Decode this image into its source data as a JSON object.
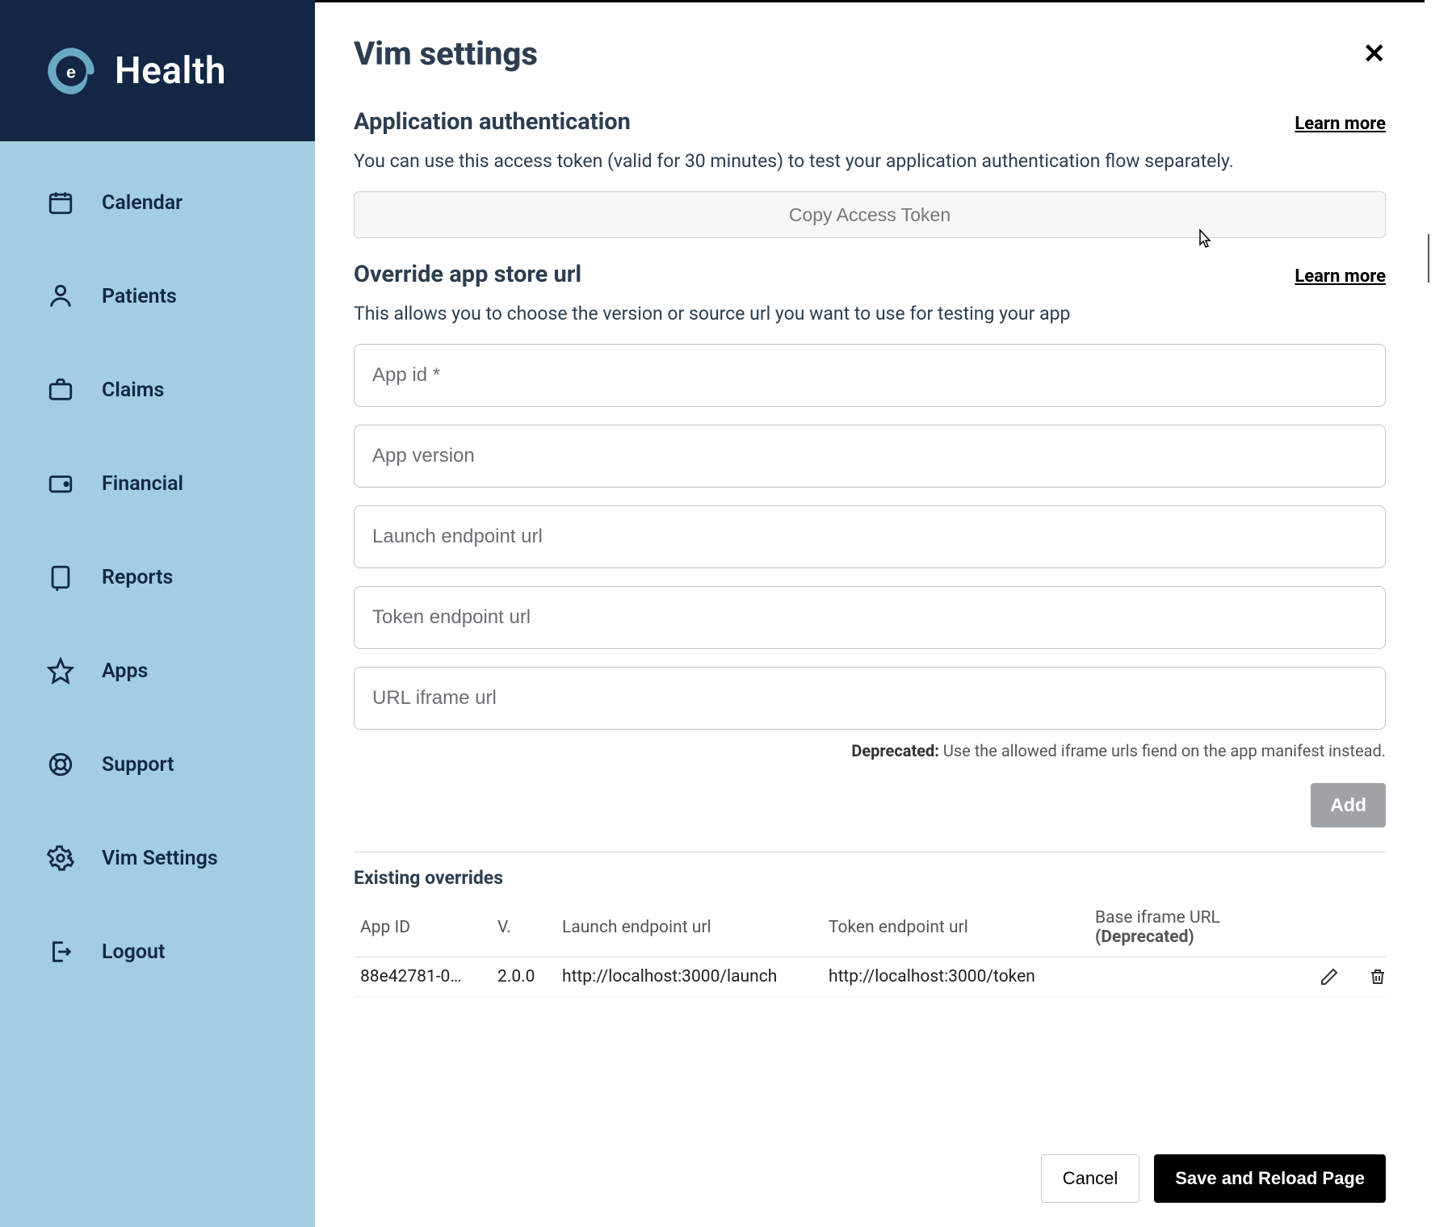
{
  "brand": {
    "name": "Health",
    "mark_letter": "e"
  },
  "sidebar": {
    "items": [
      {
        "label": "Calendar"
      },
      {
        "label": "Patients"
      },
      {
        "label": "Claims"
      },
      {
        "label": "Financial"
      },
      {
        "label": "Reports"
      },
      {
        "label": "Apps"
      },
      {
        "label": "Support"
      },
      {
        "label": "Vim Settings"
      },
      {
        "label": "Logout"
      }
    ]
  },
  "page": {
    "title": "Vim settings"
  },
  "auth": {
    "heading": "Application authentication",
    "learn": "Learn more",
    "desc": "You can use this access token (valid for 30 minutes) to test your application authentication flow separately.",
    "copy_btn": "Copy Access Token"
  },
  "override": {
    "heading": "Override app store url",
    "learn": "Learn more",
    "desc": "This allows you to choose the version or source url you want to use for testing your app",
    "placeholders": {
      "app_id": "App id *",
      "app_version": "App version",
      "launch_url": "Launch endpoint url",
      "token_url": "Token endpoint url",
      "iframe_url": "URL iframe url"
    },
    "deprecated_label": "Deprecated:",
    "deprecated_text": "Use the allowed iframe urls fiend on the app manifest instead.",
    "add_btn": "Add"
  },
  "overrides_table": {
    "heading": "Existing overrides",
    "cols": {
      "app_id": "App ID",
      "version": "V.",
      "launch": "Launch endpoint url",
      "token": "Token endpoint url",
      "iframe": "Base iframe URL",
      "iframe_deprecated": "(Deprecated)"
    },
    "rows": [
      {
        "app_id": "88e42781-0…",
        "version": "2.0.0",
        "launch": "http://localhost:3000/launch",
        "token": "http://localhost:3000/token",
        "iframe": ""
      }
    ]
  },
  "footer": {
    "cancel": "Cancel",
    "save": "Save and Reload Page"
  }
}
